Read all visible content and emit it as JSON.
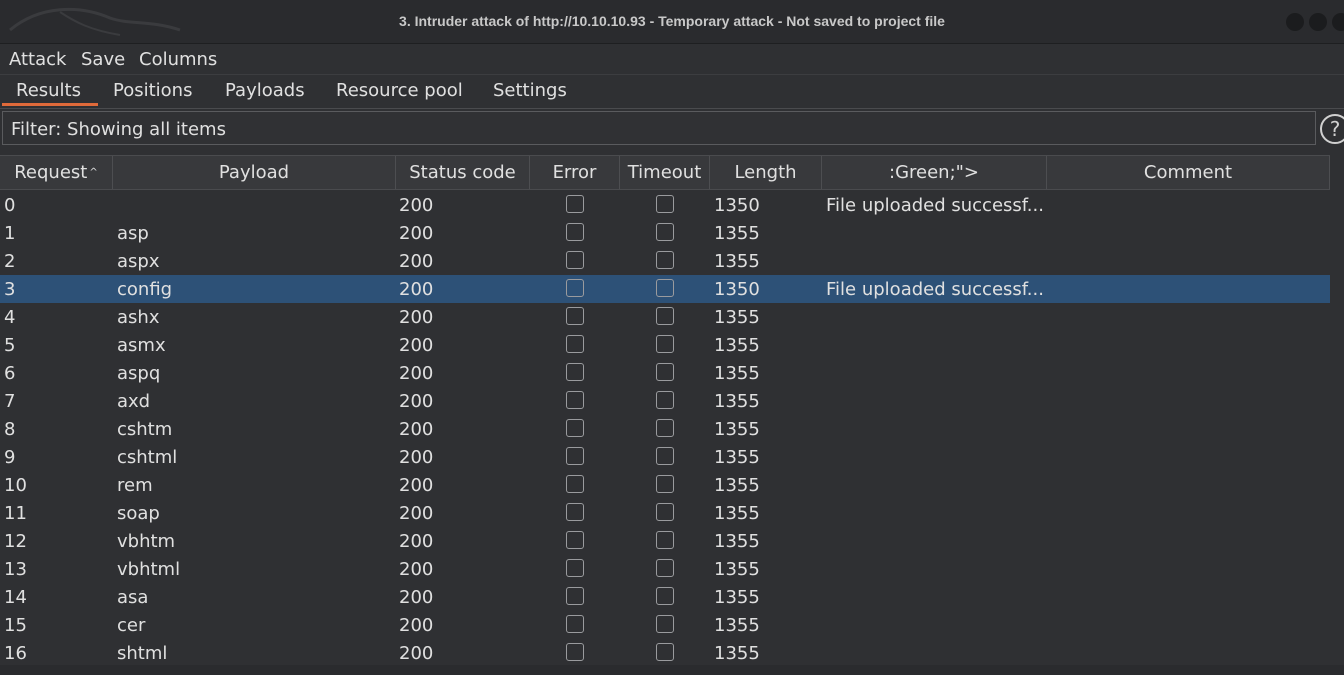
{
  "window": {
    "title": "3. Intruder attack of http://10.10.10.93 - Temporary attack - Not saved to project file"
  },
  "menu": [
    "Attack",
    "Save",
    "Columns"
  ],
  "tabs": [
    "Results",
    "Positions",
    "Payloads",
    "Resource pool",
    "Settings"
  ],
  "active_tab": "Results",
  "filter": {
    "label": "Filter: Showing all items"
  },
  "help_icon": "?",
  "table": {
    "columns": [
      "Request",
      "Payload",
      "Status code",
      "Error",
      "Timeout",
      "Length",
      ":Green;\">",
      "Comment"
    ],
    "sort_column": "Request",
    "sort_direction": "ascending",
    "rows": [
      {
        "request": "0",
        "payload": "",
        "status": "200",
        "error": false,
        "timeout": false,
        "length": "1350",
        "green": "File uploaded successf...",
        "comment": ""
      },
      {
        "request": "1",
        "payload": "asp",
        "status": "200",
        "error": false,
        "timeout": false,
        "length": "1355",
        "green": "",
        "comment": ""
      },
      {
        "request": "2",
        "payload": "aspx",
        "status": "200",
        "error": false,
        "timeout": false,
        "length": "1355",
        "green": "",
        "comment": ""
      },
      {
        "request": "3",
        "payload": "config",
        "status": "200",
        "error": false,
        "timeout": false,
        "length": "1350",
        "green": "File uploaded successf...",
        "comment": "",
        "selected": true
      },
      {
        "request": "4",
        "payload": "ashx",
        "status": "200",
        "error": false,
        "timeout": false,
        "length": "1355",
        "green": "",
        "comment": ""
      },
      {
        "request": "5",
        "payload": "asmx",
        "status": "200",
        "error": false,
        "timeout": false,
        "length": "1355",
        "green": "",
        "comment": ""
      },
      {
        "request": "6",
        "payload": "aspq",
        "status": "200",
        "error": false,
        "timeout": false,
        "length": "1355",
        "green": "",
        "comment": ""
      },
      {
        "request": "7",
        "payload": "axd",
        "status": "200",
        "error": false,
        "timeout": false,
        "length": "1355",
        "green": "",
        "comment": ""
      },
      {
        "request": "8",
        "payload": "cshtm",
        "status": "200",
        "error": false,
        "timeout": false,
        "length": "1355",
        "green": "",
        "comment": ""
      },
      {
        "request": "9",
        "payload": "cshtml",
        "status": "200",
        "error": false,
        "timeout": false,
        "length": "1355",
        "green": "",
        "comment": ""
      },
      {
        "request": "10",
        "payload": "rem",
        "status": "200",
        "error": false,
        "timeout": false,
        "length": "1355",
        "green": "",
        "comment": ""
      },
      {
        "request": "11",
        "payload": "soap",
        "status": "200",
        "error": false,
        "timeout": false,
        "length": "1355",
        "green": "",
        "comment": ""
      },
      {
        "request": "12",
        "payload": "vbhtm",
        "status": "200",
        "error": false,
        "timeout": false,
        "length": "1355",
        "green": "",
        "comment": ""
      },
      {
        "request": "13",
        "payload": "vbhtml",
        "status": "200",
        "error": false,
        "timeout": false,
        "length": "1355",
        "green": "",
        "comment": ""
      },
      {
        "request": "14",
        "payload": "asa",
        "status": "200",
        "error": false,
        "timeout": false,
        "length": "1355",
        "green": "",
        "comment": ""
      },
      {
        "request": "15",
        "payload": "cer",
        "status": "200",
        "error": false,
        "timeout": false,
        "length": "1355",
        "green": "",
        "comment": ""
      },
      {
        "request": "16",
        "payload": "shtml",
        "status": "200",
        "error": false,
        "timeout": false,
        "length": "1355",
        "green": "",
        "comment": ""
      }
    ]
  },
  "colors": {
    "selected_row": "#2d5177",
    "active_tab_underline": "#e06a3a"
  }
}
